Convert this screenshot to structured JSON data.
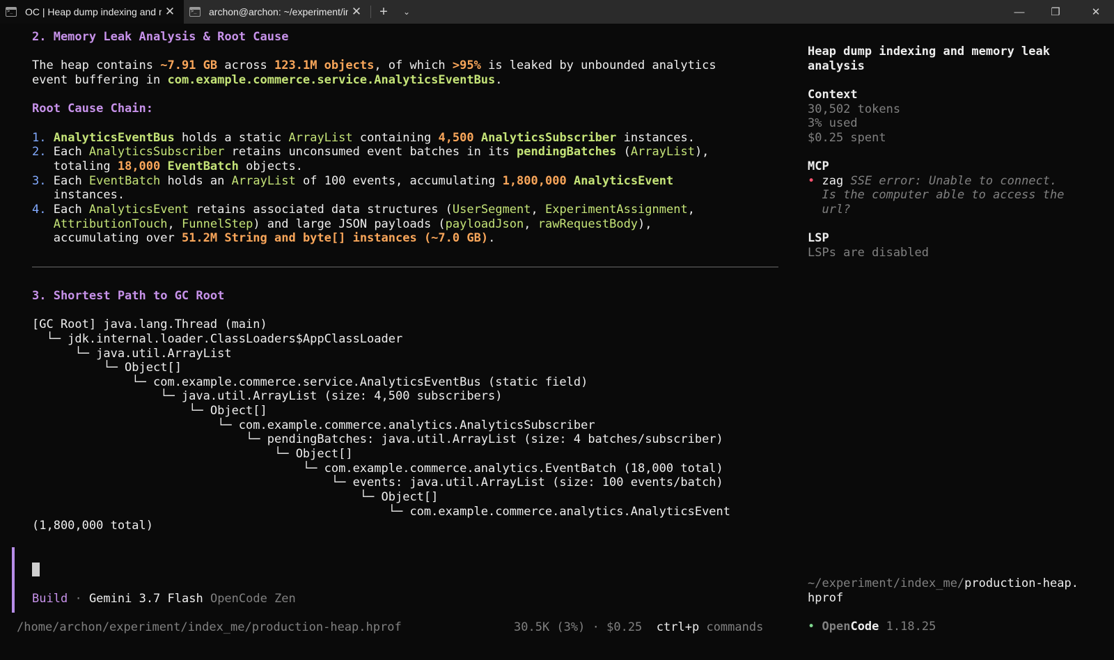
{
  "tabs": [
    {
      "title": "OC | Heap dump indexing and memory leak analysis",
      "active": true
    },
    {
      "title": "archon@archon: ~/experiment/index_me",
      "active": false
    }
  ],
  "window_controls": {
    "minimize": "—",
    "maximize": "❐",
    "close": "✕"
  },
  "section2": {
    "heading": "2. Memory Leak Analysis & Root Cause",
    "intro": {
      "t1": "The heap contains ",
      "size": "~7.91 GB",
      "t2": " across ",
      "objects": "123.1M objects",
      "t3": ", of which ",
      "pct": ">95%",
      "t4": " is leaked by unbounded analytics",
      "t5": "event buffering in ",
      "cls": "com.example.commerce.service.AnalyticsEventBus",
      "t6": "."
    },
    "chain_heading": "Root Cause Chain:",
    "items": [
      {
        "n": "1.",
        "a": "AnalyticsEventBus",
        "b": " holds a static ",
        "c": "ArrayList",
        "d": " containing ",
        "e": "4,500",
        "f": " ",
        "g": "AnalyticsSubscriber",
        "h": " instances."
      },
      {
        "n": "2.",
        "a": "Each ",
        "b": "AnalyticsSubscriber",
        "c": " retains unconsumed event batches in its ",
        "d": "pendingBatches",
        "e": " (",
        "f": "ArrayList",
        "g": "),",
        "l2a": "totaling ",
        "l2b": "18,000",
        "l2c": " ",
        "l2d": "EventBatch",
        "l2e": " objects."
      },
      {
        "n": "3.",
        "a": "Each ",
        "b": "EventBatch",
        "c": " holds an ",
        "d": "ArrayList",
        "e": " of 100 events, accumulating ",
        "f": "1,800,000",
        "g": " ",
        "h": "AnalyticsEvent",
        "l2": "instances."
      },
      {
        "n": "4.",
        "a": "Each ",
        "b": "AnalyticsEvent",
        "c": " retains associated data structures (",
        "d": "UserSegment",
        "e": ", ",
        "f": "ExperimentAssignment",
        "g": ",",
        "l2a": "AttributionTouch",
        "l2b": ", ",
        "l2c": "FunnelStep",
        "l2d": ") and large JSON payloads (",
        "l2e": "payloadJson",
        "l2f": ", ",
        "l2g": "rawRequestBody",
        "l2h": "),",
        "l3a": "accumulating over ",
        "l3b": "51.2M String and byte[] instances (~7.0 GB)",
        "l3c": "."
      }
    ]
  },
  "section3": {
    "heading": "3. Shortest Path to GC Root",
    "tree": [
      "[GC Root] java.lang.Thread (main)",
      "  └─ jdk.internal.loader.ClassLoaders$AppClassLoader",
      "      └─ java.util.ArrayList",
      "          └─ Object[]",
      "              └─ com.example.commerce.service.AnalyticsEventBus (static field)",
      "                  └─ java.util.ArrayList (size: 4,500 subscribers)",
      "                      └─ Object[]",
      "                          └─ com.example.commerce.analytics.AnalyticsSubscriber",
      "                              └─ pendingBatches: java.util.ArrayList (size: 4 batches/subscriber)",
      "                                  └─ Object[]",
      "                                      └─ com.example.commerce.analytics.EventBatch (18,000 total)",
      "                                          └─ events: java.util.ArrayList (size: 100 events/batch)",
      "                                              └─ Object[]",
      "                                                  └─ com.example.commerce.analytics.AnalyticsEvent",
      "(1,800,000 total)"
    ]
  },
  "sidebar": {
    "title_l1": "Heap dump indexing and memory leak",
    "title_l2": "analysis",
    "context_label": "Context",
    "tokens": "30,502 tokens",
    "used": "3% used",
    "spent": "$0.25 spent",
    "mcp_label": "MCP",
    "mcp_bullet": "•",
    "mcp_name": "zag",
    "mcp_err_l1": "SSE error: Unable to connect.",
    "mcp_err_l2": "Is the computer able to access the",
    "mcp_err_l3": "url?",
    "lsp_label": "LSP",
    "lsp_status": "LSPs are disabled",
    "path_l1_dim": "~/experiment/index_me/",
    "path_l1_bright": "production-heap.",
    "path_l2": "hprof",
    "oc_bullet": "•",
    "oc_open": "Open",
    "oc_code": "Code",
    "oc_version": "1.18.25"
  },
  "prompt": {
    "mode": "Build",
    "sep": "·",
    "model": "Gemini 3.7 Flash",
    "provider": "OpenCode Zen"
  },
  "statusbar": {
    "cwd": "/home/archon/experiment/index_me/production-heap.hprof",
    "usage": "30.5K (3%)",
    "sep": "·",
    "cost": "$0.25",
    "shortcut": "ctrl+p",
    "shortcut_label": "commands"
  }
}
